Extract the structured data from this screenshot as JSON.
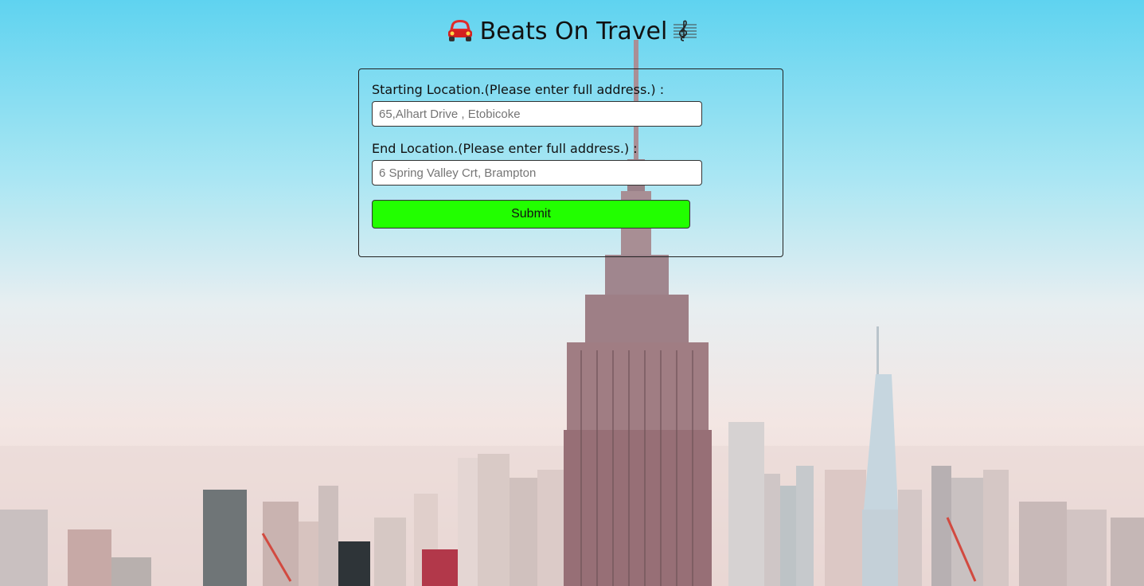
{
  "header": {
    "title": "Beats On Travel",
    "leading_icon": "red-car-icon",
    "trailing_icon": "treble-clef-icon"
  },
  "form": {
    "start_label": "Starting Location.(Please enter full address.) :",
    "start_placeholder": "65,Alhart Drive , Etobicoke",
    "end_label": "End Location.(Please enter full address.) :",
    "end_placeholder": "6 Spring Valley Crt, Brampton",
    "submit_label": "Submit"
  },
  "colors": {
    "submit_bg": "#22ff00",
    "sky": "#5fd3f0"
  }
}
